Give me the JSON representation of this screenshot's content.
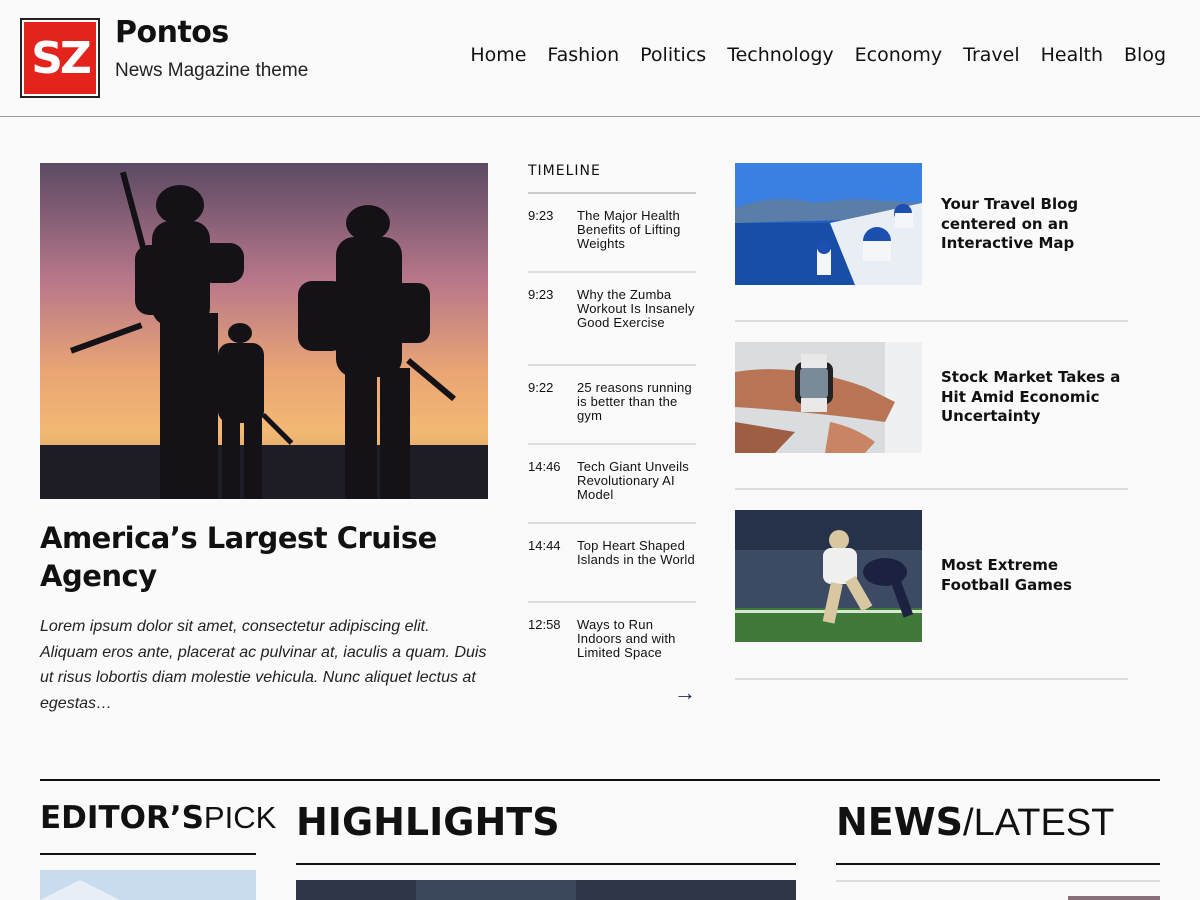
{
  "site": {
    "logo_text": "SZ",
    "title": "Pontos",
    "tagline": "News Magazine theme"
  },
  "nav": {
    "items": [
      "Home",
      "Fashion",
      "Politics",
      "Technology",
      "Economy",
      "Travel",
      "Health",
      "Blog"
    ]
  },
  "hero": {
    "title": "America’s Largest Cruise Agency",
    "excerpt": "Lorem ipsum dolor sit amet, consectetur adipiscing elit. Aliquam eros ante, placerat ac pulvinar at, iaculis a quam. Duis ut risus lobortis diam molestie vehicula. Nunc aliquet lectus at egestas…"
  },
  "timeline": {
    "heading": "TIMELINE",
    "items": [
      {
        "time": "9:23",
        "text": "The Major Health Benefits of Lifting Weights"
      },
      {
        "time": "9:23",
        "text": "Why the Zumba Workout Is Insanely Good Exercise"
      },
      {
        "time": "9:22",
        "text": "25 reasons running is better than the gym"
      },
      {
        "time": "14:46",
        "text": "Tech Giant Unveils Revolutionary AI Model"
      },
      {
        "time": "14:44",
        "text": "Top Heart Shaped Islands in the World"
      },
      {
        "time": "12:58",
        "text": "Ways to Run Indoors and with Limited Space"
      }
    ],
    "more_icon": "arrow-right-icon",
    "more_glyph": "→"
  },
  "side_posts": [
    {
      "title": "Your Travel Blog centered on an Interactive Map"
    },
    {
      "title": "Stock Market Takes a Hit Amid Economic Uncertainty"
    },
    {
      "title": "Most Extreme Football Games"
    }
  ],
  "sections": {
    "editors_bold": "EDITOR’S",
    "editors_light": "PICK",
    "highlights": "HIGHLIGHTS",
    "news_bold": "NEWS",
    "news_light": "/LATEST"
  },
  "colors": {
    "logo_red": "#e4231d",
    "background": "#fafafa",
    "text": "#111111"
  }
}
